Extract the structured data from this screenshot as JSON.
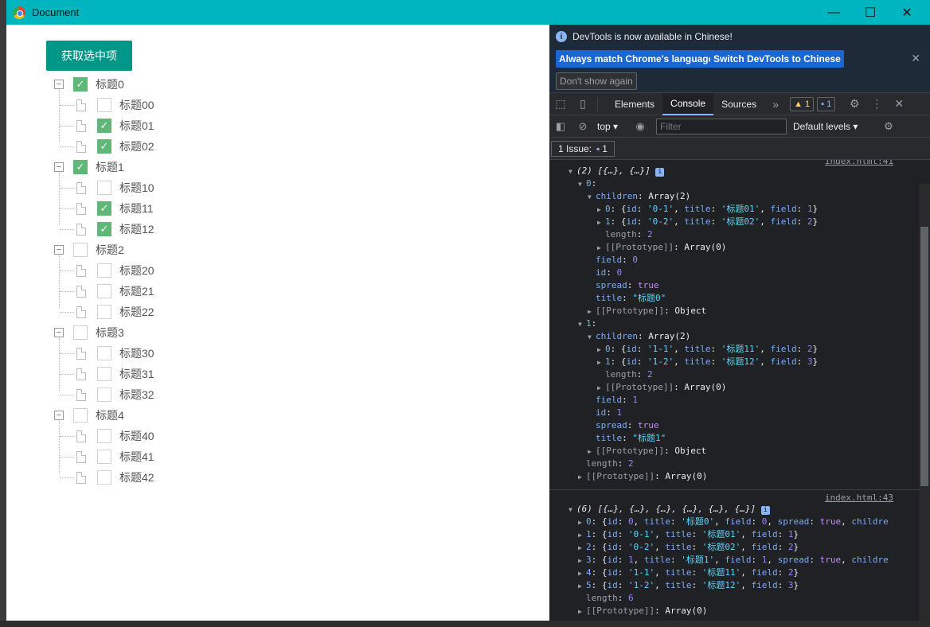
{
  "window": {
    "title": "Document"
  },
  "controls": {
    "minimize": "—",
    "maximize": "☐",
    "close": "✕"
  },
  "page": {
    "button_label": "获取选中项",
    "tree": [
      {
        "title": "标题0",
        "checked": true,
        "children": [
          {
            "title": "标题00",
            "checked": false
          },
          {
            "title": "标题01",
            "checked": true
          },
          {
            "title": "标题02",
            "checked": true
          }
        ]
      },
      {
        "title": "标题1",
        "checked": true,
        "children": [
          {
            "title": "标题10",
            "checked": false
          },
          {
            "title": "标题11",
            "checked": true
          },
          {
            "title": "标题12",
            "checked": true
          }
        ]
      },
      {
        "title": "标题2",
        "checked": false,
        "children": [
          {
            "title": "标题20",
            "checked": false
          },
          {
            "title": "标题21",
            "checked": false
          },
          {
            "title": "标题22",
            "checked": false
          }
        ]
      },
      {
        "title": "标题3",
        "checked": false,
        "children": [
          {
            "title": "标题30",
            "checked": false
          },
          {
            "title": "标题31",
            "checked": false
          },
          {
            "title": "标题32",
            "checked": false
          }
        ]
      },
      {
        "title": "标题4",
        "checked": false,
        "children": [
          {
            "title": "标题40",
            "checked": false
          },
          {
            "title": "标题41",
            "checked": false
          },
          {
            "title": "标题42",
            "checked": false
          }
        ]
      }
    ]
  },
  "devtools": {
    "info_message": "DevTools is now available in Chinese!",
    "btn_match": "Always match Chrome's language",
    "btn_switch": "Switch DevTools to Chinese",
    "btn_dont_show": "Don't show again",
    "tabs": [
      "Elements",
      "Console",
      "Sources"
    ],
    "active_tab": "Console",
    "warn_count": "1",
    "msg_count": "1",
    "context": "top",
    "filter_placeholder": "Filter",
    "levels": "Default levels",
    "issues_label": "1 Issue:",
    "issues_count": "1",
    "log1_src": "index.html:41",
    "log2_src": "index.html:43"
  }
}
